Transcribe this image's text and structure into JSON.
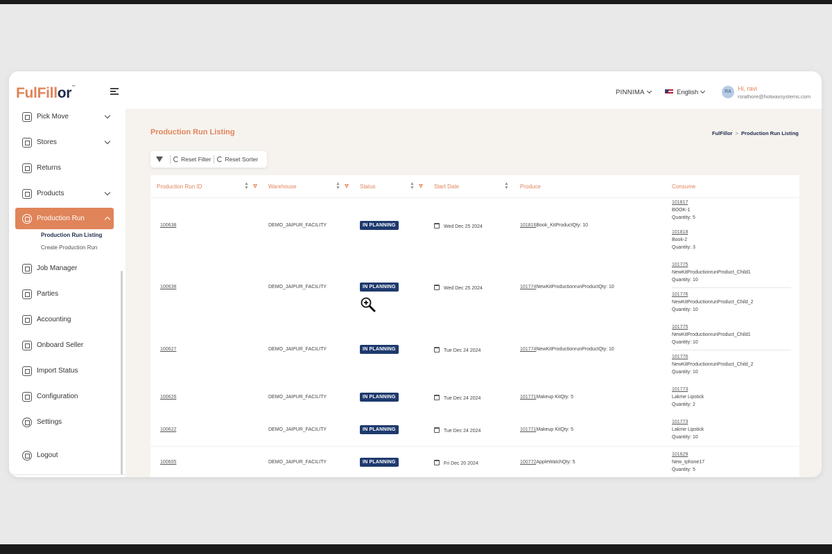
{
  "app": {
    "logo": {
      "part1": "Ful",
      "part2": "Fill",
      "part3": "or",
      "tm": "™"
    },
    "org": "PINNIMA",
    "language": "English",
    "user": {
      "initials": "RA",
      "greeting": "Hi, ravi",
      "email": "rsrathore@hotwaxsystems.com"
    }
  },
  "sidebar": {
    "items": [
      {
        "label": "Pick Move"
      },
      {
        "label": "Stores"
      },
      {
        "label": "Returns"
      },
      {
        "label": "Products"
      },
      {
        "label": "Production Run"
      },
      {
        "label": "Job Manager"
      },
      {
        "label": "Parties"
      },
      {
        "label": "Accounting"
      },
      {
        "label": "Onboard Seller"
      },
      {
        "label": "Import Status"
      },
      {
        "label": "Configuration"
      },
      {
        "label": "Settings"
      }
    ],
    "sub_items": [
      {
        "label": "Production Run Listing"
      },
      {
        "label": "Create Production Run"
      }
    ],
    "logout": "Logout"
  },
  "page": {
    "title": "Production Run Listing",
    "breadcrumb": [
      "FulFillor",
      "Production Run Listing"
    ],
    "toolbar": {
      "reset_filter": "Reset Filter",
      "reset_sorter": "Reset Sorter"
    }
  },
  "table": {
    "columns": [
      "Production Run ID",
      "Warehouse",
      "Status",
      "Start Date",
      "Produce",
      "Consume"
    ],
    "rows": [
      {
        "id": "100638",
        "warehouse": "DEMO_JAIPUR_FACILITY",
        "status": "IN PLANNING",
        "start": "Wed Dec 25 2024",
        "produce_id": "101816",
        "produce_rest": "Book_KitProductQty: 10",
        "consume": [
          {
            "id": "101817",
            "name": "BOOK-1",
            "qty": "Quantity: 5"
          },
          {
            "id": "101818",
            "name": "Book-2",
            "qty": "Quantity: 3"
          }
        ]
      },
      {
        "id": "100638",
        "warehouse": "DEMO_JAIPUR_FACILITY",
        "status": "IN PLANNING",
        "start": "Wed Dec 25 2024",
        "produce_id": "101774",
        "produce_rest": "NewKitProductionrunProductQty: 10",
        "consume": [
          {
            "id": "101775",
            "name": "NewKitProductionrunProduct_Child1",
            "qty": "Quantity: 10"
          },
          {
            "id": "101776",
            "name": "NewKitProductionrunProduct_Child_2",
            "qty": "Quantity: 10"
          }
        ]
      },
      {
        "id": "100627",
        "warehouse": "DEMO_JAIPUR_FACILITY",
        "status": "IN PLANNING",
        "start": "Tue Dec 24 2024",
        "produce_id": "101774",
        "produce_rest": "NewKitProductionrunProductQty: 10",
        "consume": [
          {
            "id": "101775",
            "name": "NewKitProductionrunProduct_Child1",
            "qty": "Quantity: 10"
          },
          {
            "id": "101776",
            "name": "NewKitProductionrunProduct_Child_2",
            "qty": "Quantity: 10"
          }
        ]
      },
      {
        "id": "100626",
        "warehouse": "DEMO_JAIPUR_FACILITY",
        "status": "IN PLANNING",
        "start": "Tue Dec 24 2024",
        "produce_id": "101771",
        "produce_rest": "Makeup KitQty: 5",
        "consume": [
          {
            "id": "101773",
            "name": "Lakme Lipstick",
            "qty": "Quantity: 2"
          }
        ]
      },
      {
        "id": "100622",
        "warehouse": "DEMO_JAIPUR_FACILITY",
        "status": "IN PLANNING",
        "start": "Tue Dec 24 2024",
        "produce_id": "101771",
        "produce_rest": "Makeup KitQty: 5",
        "consume": [
          {
            "id": "101773",
            "name": "Lakme Lipstick",
            "qty": "Quantity: 10"
          }
        ]
      },
      {
        "id": "100605",
        "warehouse": "DEMO_JAIPUR_FACILITY",
        "status": "IN PLANNING",
        "start": "Fri Dec 20 2024",
        "produce_id": "100772",
        "produce_rest": "AppleWatchQty: 5",
        "consume": [
          {
            "id": "101629",
            "name": "New_Iphone17",
            "qty": "Quantity: 5"
          }
        ]
      }
    ]
  },
  "colors": {
    "accent": "#e0845a",
    "navy": "#1e3a6e",
    "main_bg": "#f6f3ef"
  }
}
